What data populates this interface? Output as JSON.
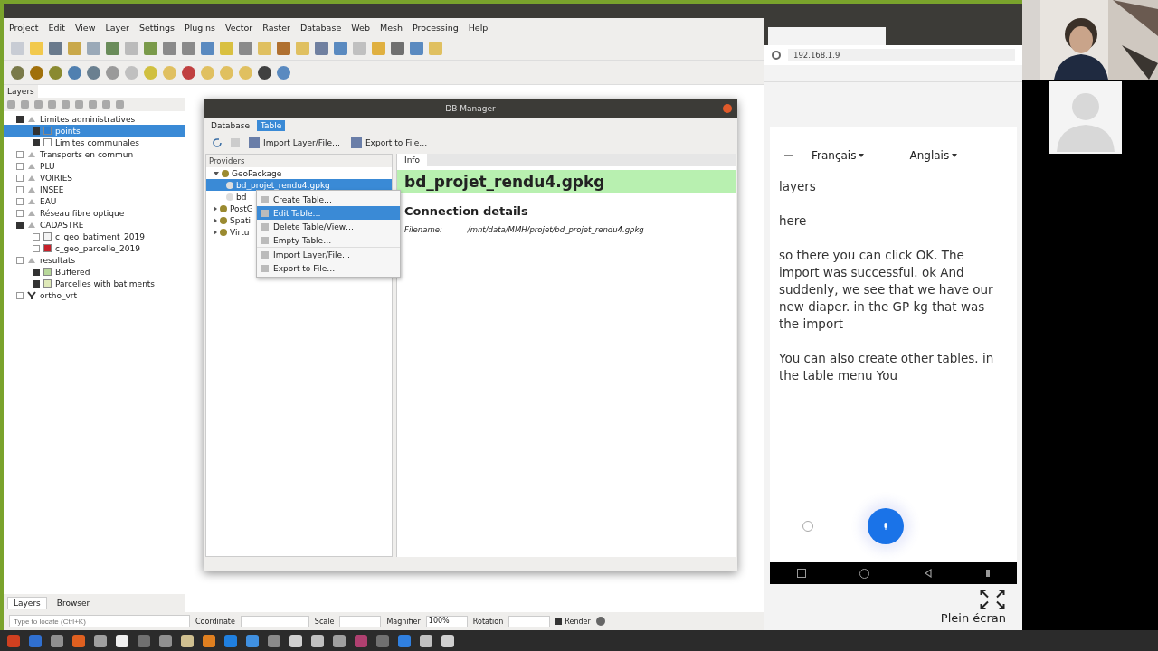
{
  "qgis": {
    "menu": [
      "Project",
      "Edit",
      "View",
      "Layer",
      "Settings",
      "Plugins",
      "Vector",
      "Raster",
      "Database",
      "Web",
      "Mesh",
      "Processing",
      "Help"
    ],
    "layers_panel": {
      "title": "Layers",
      "tree": [
        {
          "label": "Limites administratives",
          "kind": "group",
          "checked": true,
          "selected": false,
          "children": [
            {
              "label": "points",
              "kind": "layer",
              "checked": true,
              "selected": true,
              "color": "#2f7fd0"
            },
            {
              "label": "Limites communales",
              "kind": "layer",
              "checked": true,
              "selected": false,
              "color": "#ffffff"
            }
          ]
        },
        {
          "label": "Transports en commun",
          "kind": "group",
          "checked": false,
          "selected": false
        },
        {
          "label": "PLU",
          "kind": "group",
          "checked": false,
          "selected": false
        },
        {
          "label": "VOIRIES",
          "kind": "group",
          "checked": false,
          "selected": false
        },
        {
          "label": "INSEE",
          "kind": "group",
          "checked": false,
          "selected": false
        },
        {
          "label": "EAU",
          "kind": "group",
          "checked": false,
          "selected": false
        },
        {
          "label": "Réseau fibre optique",
          "kind": "group",
          "checked": false,
          "selected": false
        },
        {
          "label": "CADASTRE",
          "kind": "group",
          "checked": true,
          "selected": false,
          "children": [
            {
              "label": "c_geo_batiment_2019",
              "kind": "layer",
              "checked": false,
              "selected": false,
              "color": "#f4f4f4"
            },
            {
              "label": "c_geo_parcelle_2019",
              "kind": "layer",
              "checked": false,
              "selected": false,
              "color": "#c8202a"
            }
          ]
        },
        {
          "label": "resultats",
          "kind": "group",
          "checked": false,
          "selected": false,
          "children": [
            {
              "label": "Buffered",
              "kind": "layer",
              "checked": true,
              "selected": false,
              "color": "#b8d89a"
            },
            {
              "label": "Parcelles with batiments",
              "kind": "layer",
              "checked": true,
              "selected": false,
              "color": "#dfe9b8"
            }
          ]
        },
        {
          "label": "ortho_vrt",
          "kind": "raster",
          "checked": false,
          "selected": false
        }
      ]
    },
    "panel_tabs": [
      {
        "label": "Layers",
        "selected": true
      },
      {
        "label": "Browser",
        "selected": false
      }
    ],
    "locator": {
      "placeholder": "Type to locate (Ctrl+K)"
    },
    "status_bar": {
      "coordinate_label": "Coordinate",
      "scale_label": "Scale",
      "magnifier_label": "Magnifier",
      "magnifier": "100%",
      "rotation_label": "Rotation",
      "render_label": "Render",
      "render": true
    }
  },
  "db_manager": {
    "title": "DB Manager",
    "menu": [
      {
        "label": "Database",
        "selected": false
      },
      {
        "label": "Table",
        "selected": true
      }
    ],
    "toolbar": [
      "Import Layer/File…",
      "Export to File…"
    ],
    "providers_label": "Providers",
    "tree": [
      {
        "label": "GeoPackage",
        "expanded": true,
        "selected": false,
        "children": [
          {
            "label": "bd_projet_rendu4.gpkg",
            "selected": true
          },
          {
            "label": "bd",
            "selected": false
          }
        ]
      },
      {
        "label": "PostG",
        "expanded": false,
        "selected": false
      },
      {
        "label": "Spati",
        "expanded": false,
        "selected": false
      },
      {
        "label": "Virtu",
        "expanded": false,
        "selected": false
      }
    ],
    "context_menu": [
      {
        "label": "Create Table…",
        "selected": false
      },
      {
        "label": "Edit Table…",
        "selected": true
      },
      {
        "label": "Delete Table/View…",
        "selected": false
      },
      {
        "label": "Empty Table…",
        "selected": false
      },
      {
        "label": "Import Layer/File…",
        "selected": false
      },
      {
        "label": "Export to File…",
        "selected": false
      }
    ],
    "tabs": [
      {
        "label": "Info",
        "selected": true
      }
    ],
    "heading": "bd_projet_rendu4.gpkg",
    "section": "Connection details",
    "filename_label": "Filename:",
    "filename": "/mnt/data/MMH/projet/bd_projet_rendu4.gpkg"
  },
  "browser": {
    "url": "192.168.1.9",
    "phone": {
      "source_language": "Français",
      "target_language": "Anglais",
      "transcript": [
        "layers",
        "here",
        "so there you can click OK. The import was successful. ok And suddenly, we see that we have our new diaper. in the GP kg that was the import",
        "You can also create other tables. in the table menu You"
      ]
    },
    "fullscreen_label": "Plein écran"
  }
}
